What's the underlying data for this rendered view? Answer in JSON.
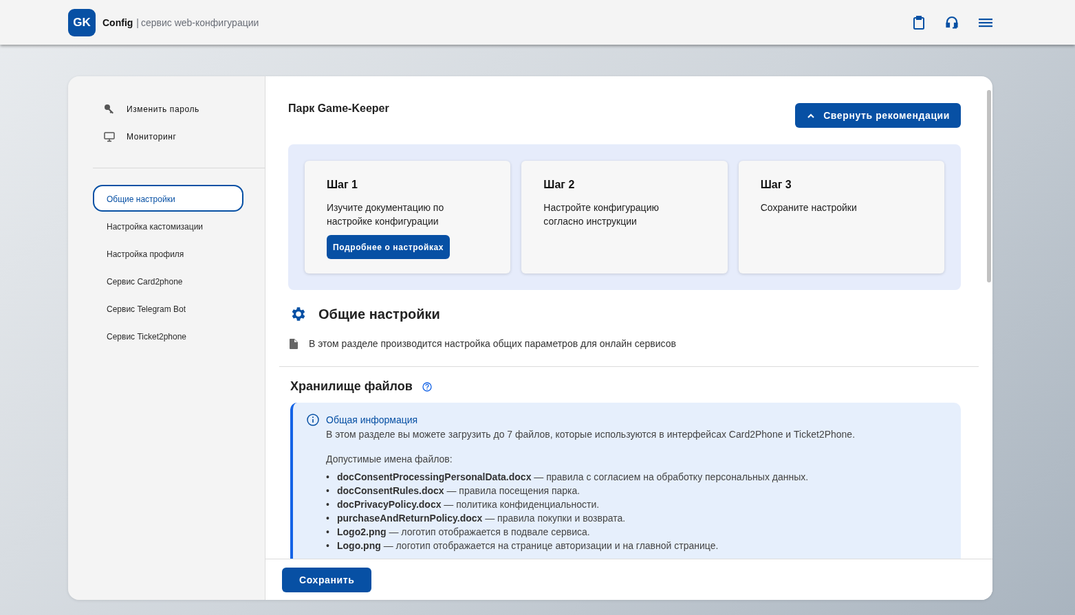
{
  "header": {
    "logo": "GK",
    "app_name": "Config",
    "separator": "|",
    "subtitle": "сервис web-конфигурации"
  },
  "sidebar": {
    "top_items": [
      {
        "kind": "key",
        "label": "Изменить пароль"
      },
      {
        "kind": "monitor",
        "label": "Мониторинг"
      }
    ],
    "items": [
      {
        "label": "Общие настройки",
        "selected": true
      },
      {
        "label": "Настройка кастомизации",
        "selected": false
      },
      {
        "label": "Настройка профиля",
        "selected": false
      },
      {
        "label": "Сервис Card2phone",
        "selected": false
      },
      {
        "label": "Сервис Telegram Bot",
        "selected": false
      },
      {
        "label": "Сервис Ticket2phone",
        "selected": false
      }
    ]
  },
  "main": {
    "title": "Парк Game-Keeper",
    "collapse_button": "Свернуть рекомендации",
    "steps": [
      {
        "title": "Шаг 1",
        "text": "Изучите документацию по настройке конфигурации",
        "button": "Подробнее о настройках"
      },
      {
        "title": "Шаг 2",
        "text": "Настройте конфигурацию согласно инструкции"
      },
      {
        "title": "Шаг 3",
        "text": "Сохраните настройки"
      }
    ],
    "section": {
      "title": "Общие настройки",
      "description": "В этом разделе производится настройка общих параметров для онлайн сервисов"
    },
    "storage": {
      "title": "Хранилище файлов",
      "info": {
        "title": "Общая информация",
        "intro": "В этом разделе вы можете загрузить до 7 файлов, которые используются в интерфейсах Card2Phone и Ticket2Phone.",
        "list_heading": "Допустимые имена файлов:",
        "bullet": "•",
        "files": [
          "**docConsentProcessingPersonalData.docx** — правила с согласием на обработку персональных данных.",
          "**docConsentRules.docx** — правила посещения парка.",
          "**docPrivacyPolicy.docx** — политика конфиденциальности.",
          "**purchaseAndReturnPolicy.docx** — правила покупки и возврата.",
          "**Logo2.png** — логотип отображается в подвале сервиса.",
          "**Logo.png** — логотип отображается на странице авторизации и на главной странице."
        ]
      }
    },
    "save_button": "Сохранить"
  }
}
